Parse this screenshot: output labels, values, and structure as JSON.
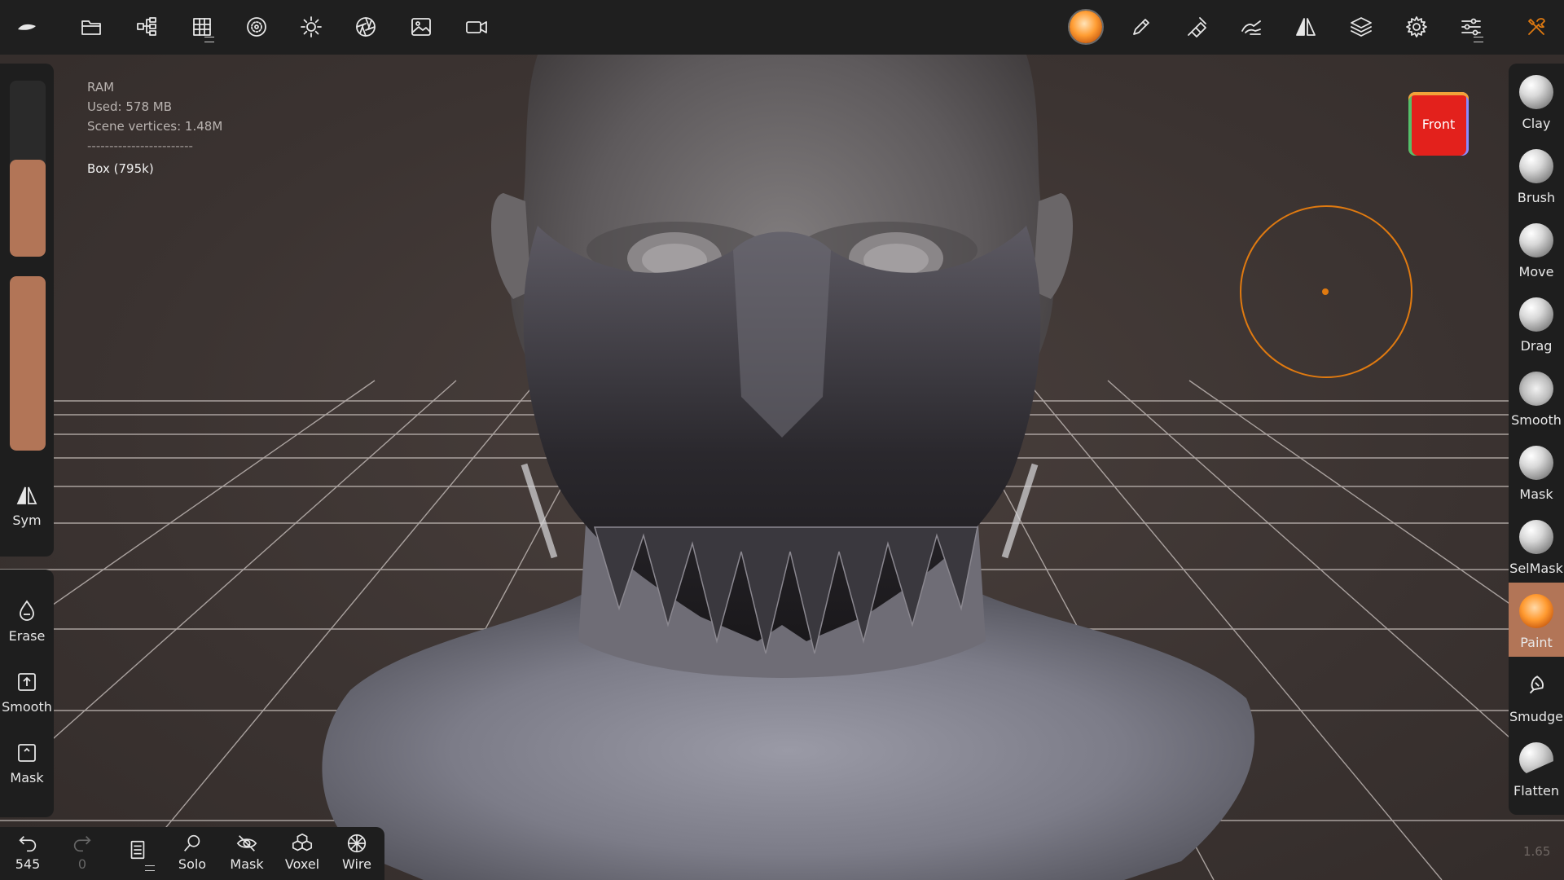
{
  "topbar": {
    "left_icons": [
      "app-logo-icon",
      "folder-icon",
      "scene-tree-icon",
      "grid-icon",
      "material-sphere-icon",
      "light-icon",
      "aperture-icon",
      "image-icon",
      "camera-icon"
    ],
    "right_icons": [
      "material-ball-icon",
      "pen-icon",
      "stroke-pen-icon",
      "paint-tool-icon",
      "symmetry-icon",
      "layers-icon",
      "settings-icon",
      "sliders-icon",
      "tools-icon"
    ],
    "accent_color": "#e07a10"
  },
  "info": {
    "ram_label": "RAM",
    "used": "Used: 578 MB",
    "vertices": "Scene vertices: 1.48M",
    "separator": "------------------------",
    "mesh": "Box (795k)"
  },
  "left_panel": {
    "radius_slider_level": 0.55,
    "intensity_slider_level": 1.0,
    "slider_color": "#b27557",
    "sym_label": "Sym",
    "buttons": [
      {
        "label": "Erase",
        "icon": "drop-icon"
      },
      {
        "label": "Smooth",
        "icon": "smooth-box-icon"
      },
      {
        "label": "Mask",
        "icon": "mask-box-icon"
      }
    ]
  },
  "bottombar": {
    "undo_count": "545",
    "redo_count": "0",
    "buttons": [
      {
        "label": "Solo",
        "icon": "search-icon"
      },
      {
        "label": "Mask",
        "icon": "eye-off-icon"
      },
      {
        "label": "Voxel",
        "icon": "cubes-icon"
      },
      {
        "label": "Wire",
        "icon": "wire-sphere-icon"
      }
    ]
  },
  "right_panel": {
    "tools": [
      "Clay",
      "Brush",
      "Move",
      "Drag",
      "Smooth",
      "Mask",
      "SelMask",
      "Paint",
      "Smudge",
      "Flatten"
    ],
    "active_tool": "Paint"
  },
  "view_cube": {
    "label": "Front"
  },
  "zoom_readout": "1.65"
}
